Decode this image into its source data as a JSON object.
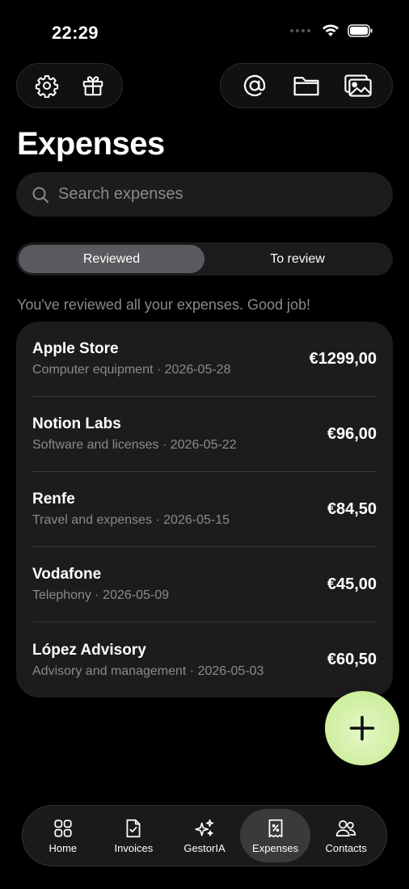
{
  "status_bar": {
    "time": "22:29"
  },
  "header": {
    "left_icons": [
      "gear-icon",
      "gift-icon"
    ],
    "right_icons": [
      "at-sign-icon",
      "folder-icon",
      "images-icon"
    ]
  },
  "page": {
    "title": "Expenses"
  },
  "search": {
    "placeholder": "Search expenses",
    "value": ""
  },
  "segments": {
    "items": [
      {
        "label": "Reviewed",
        "active": true
      },
      {
        "label": "To review",
        "active": false
      }
    ]
  },
  "info_message": "You've reviewed all your expenses. Good job!",
  "expenses": [
    {
      "vendor": "Apple Store",
      "detail": "Computer equipment · 2026-05-28",
      "amount": "€1299,00"
    },
    {
      "vendor": "Notion Labs",
      "detail": "Software and licenses · 2026-05-22",
      "amount": "€96,00"
    },
    {
      "vendor": "Renfe",
      "detail": "Travel and expenses · 2026-05-15",
      "amount": "€84,50"
    },
    {
      "vendor": "Vodafone",
      "detail": "Telephony · 2026-05-09",
      "amount": "€45,00"
    },
    {
      "vendor": "López Advisory",
      "detail": "Advisory and management · 2026-05-03",
      "amount": "€60,50"
    }
  ],
  "fab": {
    "icon": "plus-icon",
    "color": "#d2f0a6"
  },
  "tabbar": {
    "items": [
      {
        "label": "Home",
        "icon": "grid-icon",
        "active": false
      },
      {
        "label": "Invoices",
        "icon": "invoice-icon",
        "active": false
      },
      {
        "label": "GestorIA",
        "icon": "sparkles-icon",
        "active": false
      },
      {
        "label": "Expenses",
        "icon": "receipt-icon",
        "active": true
      },
      {
        "label": "Contacts",
        "icon": "contacts-icon",
        "active": false
      }
    ]
  }
}
